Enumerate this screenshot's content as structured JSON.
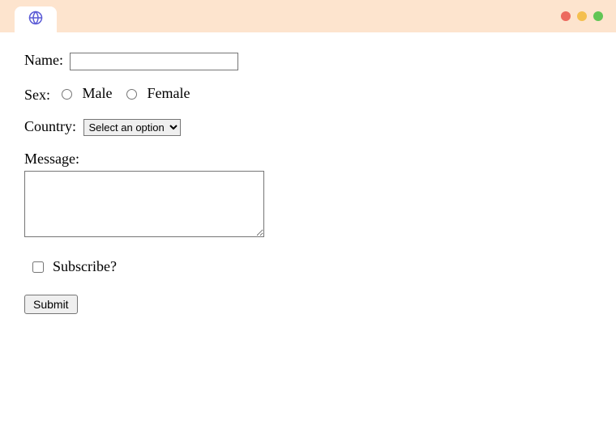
{
  "form": {
    "name_label": "Name:",
    "name_value": "",
    "sex_label": "Sex:",
    "sex_options": {
      "male": "Male",
      "female": "Female"
    },
    "country_label": "Country:",
    "country_selected": "Select an option",
    "message_label": "Message:",
    "message_value": "",
    "subscribe_label": "Subscribe?",
    "submit_label": "Submit"
  }
}
